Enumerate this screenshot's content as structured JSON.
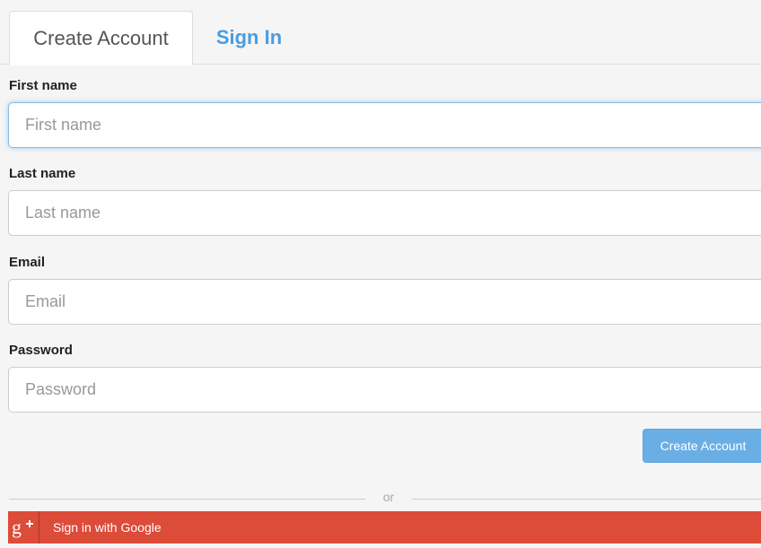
{
  "tabs": {
    "create_account": "Create Account",
    "sign_in": "Sign In"
  },
  "form": {
    "first_name": {
      "label": "First name",
      "placeholder": "First name",
      "value": ""
    },
    "last_name": {
      "label": "Last name",
      "placeholder": "Last name",
      "value": ""
    },
    "email": {
      "label": "Email",
      "placeholder": "Email",
      "value": ""
    },
    "password": {
      "label": "Password",
      "placeholder": "Password",
      "value": ""
    },
    "submit_label": "Create Account"
  },
  "divider_text": "or",
  "google": {
    "icon": "google-plus-icon",
    "label": "Sign in with Google"
  },
  "colors": {
    "accent": "#4a9de0",
    "button": "#6aaee6",
    "google": "#dd4b39"
  }
}
